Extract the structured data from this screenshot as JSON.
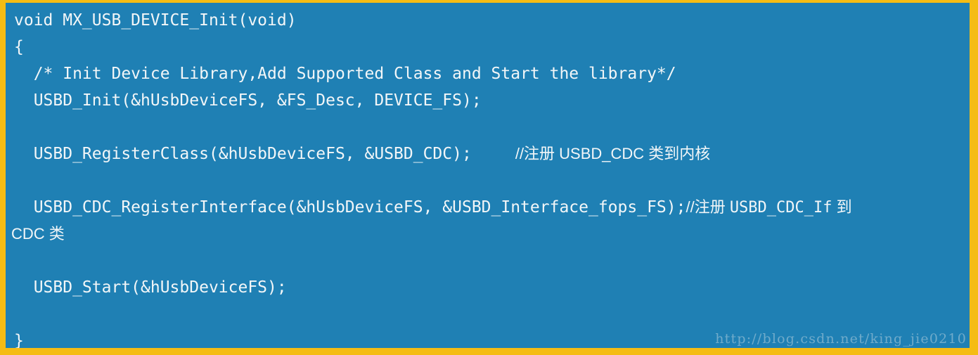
{
  "figure": {
    "kind": "code-snippet-image",
    "language": "c",
    "background_color": "#1f80b4",
    "border_color": "#f5bc14",
    "text_color": "#f2f6f8",
    "watermark_color": "#7fb3cf"
  },
  "code": {
    "lines": [
      {
        "id": "line-1",
        "text": "void MX_USB_DEVICE_Init(void)"
      },
      {
        "id": "line-2",
        "text": "{"
      },
      {
        "id": "line-3",
        "text": "  /* Init Device Library,Add Supported Class and Start the library*/"
      },
      {
        "id": "line-4",
        "text": "  USBD_Init(&hUsbDeviceFS, &FS_Desc, DEVICE_FS);"
      },
      {
        "id": "line-5",
        "text": ""
      },
      {
        "id": "line-6",
        "code": "  USBD_RegisterClass(&hUsbDeviceFS, &USBD_CDC);",
        "comment": "//注册 USBD_CDC 类到内核"
      },
      {
        "id": "line-7",
        "text": ""
      },
      {
        "id": "line-8",
        "code": "  USBD_CDC_RegisterInterface(&hUsbDeviceFS, &USBD_Interface_fops_FS);",
        "comment_prefix": "//注册 ",
        "comment_mono": "USBD_CDC_If",
        "comment_suffix": " 到"
      },
      {
        "id": "line-9",
        "text": "CDC 类"
      },
      {
        "id": "line-10",
        "text": ""
      },
      {
        "id": "line-11",
        "text": "  USBD_Start(&hUsbDeviceFS);"
      },
      {
        "id": "line-12",
        "text": ""
      },
      {
        "id": "line-13",
        "text": "}"
      }
    ]
  },
  "watermark": {
    "text": "http://blog.csdn.net/king_jie0210"
  }
}
